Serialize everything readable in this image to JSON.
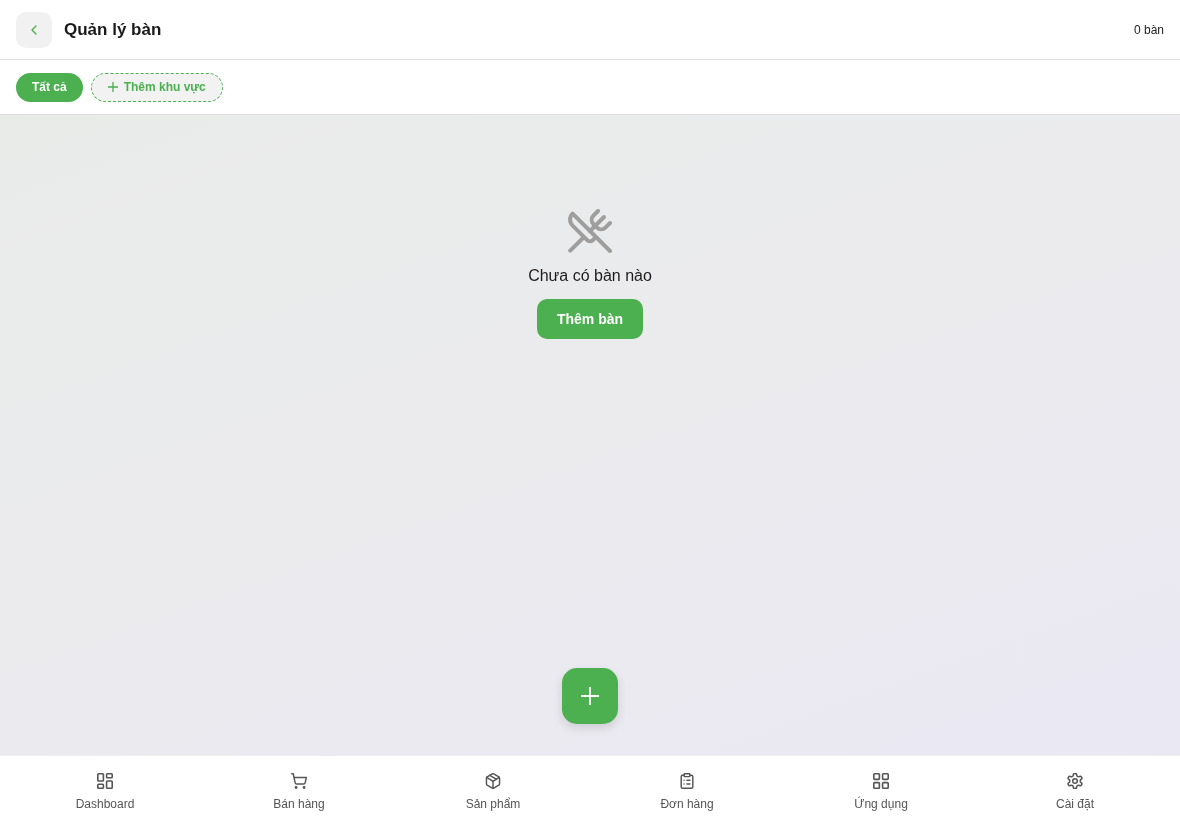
{
  "header": {
    "title": "Quản lý bàn",
    "count": "0 bàn"
  },
  "filters": [
    {
      "label": "Tất cả",
      "selected": true
    }
  ],
  "add_area_button": {
    "label": "Thêm khu vực"
  },
  "empty_state": {
    "message": "Chưa có bàn nào",
    "button": "Thêm bàn"
  },
  "bottom_nav": [
    {
      "label": "Dashboard",
      "selected": false
    },
    {
      "label": "Bán hàng",
      "selected": false
    },
    {
      "label": "Sản phẩm",
      "selected": false
    },
    {
      "label": "Đơn hàng",
      "selected": false
    },
    {
      "label": "Ứng dụng",
      "selected": false
    },
    {
      "label": "Cài đặt",
      "selected": false
    }
  ]
}
